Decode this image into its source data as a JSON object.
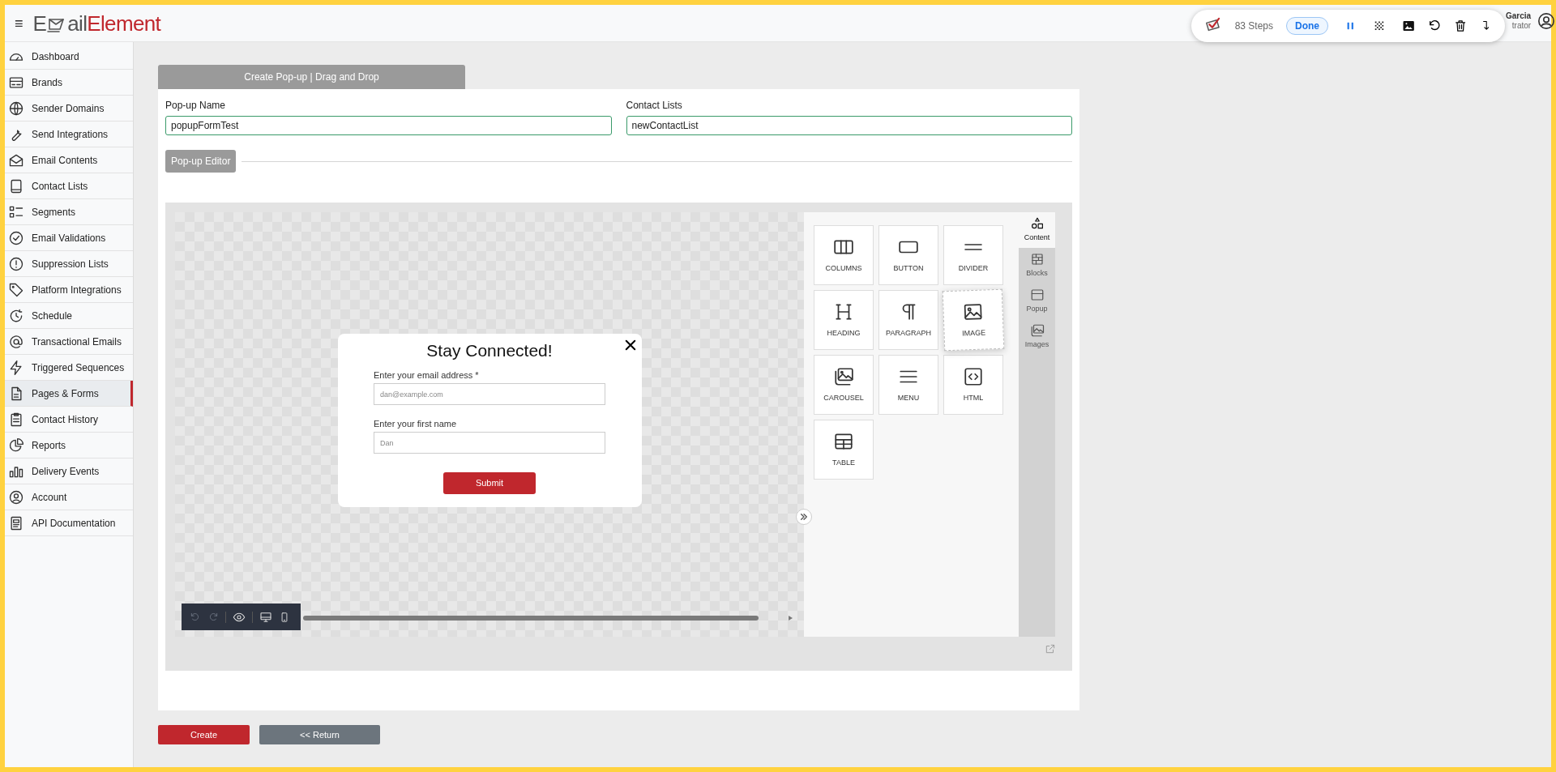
{
  "header": {
    "menu_glyph": "≡",
    "logo_start": "E",
    "logo_mid": "ail",
    "logo_end": "Element"
  },
  "recorder": {
    "steps": "83 Steps",
    "done": "Done"
  },
  "user": {
    "name": "Garcia",
    "role": "trator"
  },
  "sidebar": {
    "items": [
      {
        "label": "Dashboard",
        "selected": false
      },
      {
        "label": "Brands",
        "selected": false
      },
      {
        "label": "Sender Domains",
        "selected": false
      },
      {
        "label": "Send Integrations",
        "selected": false
      },
      {
        "label": "Email Contents",
        "selected": false
      },
      {
        "label": "Contact Lists",
        "selected": false
      },
      {
        "label": "Segments",
        "selected": false
      },
      {
        "label": "Email Validations",
        "selected": false
      },
      {
        "label": "Suppression Lists",
        "selected": false
      },
      {
        "label": "Platform Integrations",
        "selected": false
      },
      {
        "label": "Schedule",
        "selected": false
      },
      {
        "label": "Transactional Emails",
        "selected": false
      },
      {
        "label": "Triggered Sequences",
        "selected": false
      },
      {
        "label": "Pages & Forms",
        "selected": true
      },
      {
        "label": "Contact History",
        "selected": false
      },
      {
        "label": "Reports",
        "selected": false
      },
      {
        "label": "Delivery Events",
        "selected": false
      },
      {
        "label": "Account",
        "selected": false
      },
      {
        "label": "API Documentation",
        "selected": false
      }
    ]
  },
  "form": {
    "tab": "Create Pop-up | Drag and Drop",
    "fields": [
      {
        "label": "Pop-up Name",
        "value": "popupFormTest"
      },
      {
        "label": "Contact Lists",
        "value": "newContactList"
      }
    ],
    "section": "Pop-up Editor"
  },
  "popup": {
    "title": "Stay Connected!",
    "fields": [
      {
        "label": "Enter your email address *",
        "placeholder": "dan@example.com"
      },
      {
        "label": "Enter your first name",
        "placeholder": "Dan"
      }
    ],
    "submit": "Submit"
  },
  "panel": {
    "tiles": [
      {
        "label": "COLUMNS",
        "dragging": false
      },
      {
        "label": "BUTTON",
        "dragging": false
      },
      {
        "label": "DIVIDER",
        "dragging": false
      },
      {
        "label": "HEADING",
        "dragging": false
      },
      {
        "label": "PARAGRAPH",
        "dragging": false
      },
      {
        "label": "IMAGE",
        "dragging": true
      },
      {
        "label": "CAROUSEL",
        "dragging": false
      },
      {
        "label": "MENU",
        "dragging": false
      },
      {
        "label": "HTML",
        "dragging": false
      },
      {
        "label": "TABLE",
        "dragging": false
      }
    ],
    "tabs": [
      {
        "label": "Content",
        "selected": true
      },
      {
        "label": "Blocks",
        "selected": false
      },
      {
        "label": "Popup",
        "selected": false
      },
      {
        "label": "Images",
        "selected": false
      }
    ]
  },
  "buttons": {
    "create": "Create",
    "return": "<< Return"
  }
}
